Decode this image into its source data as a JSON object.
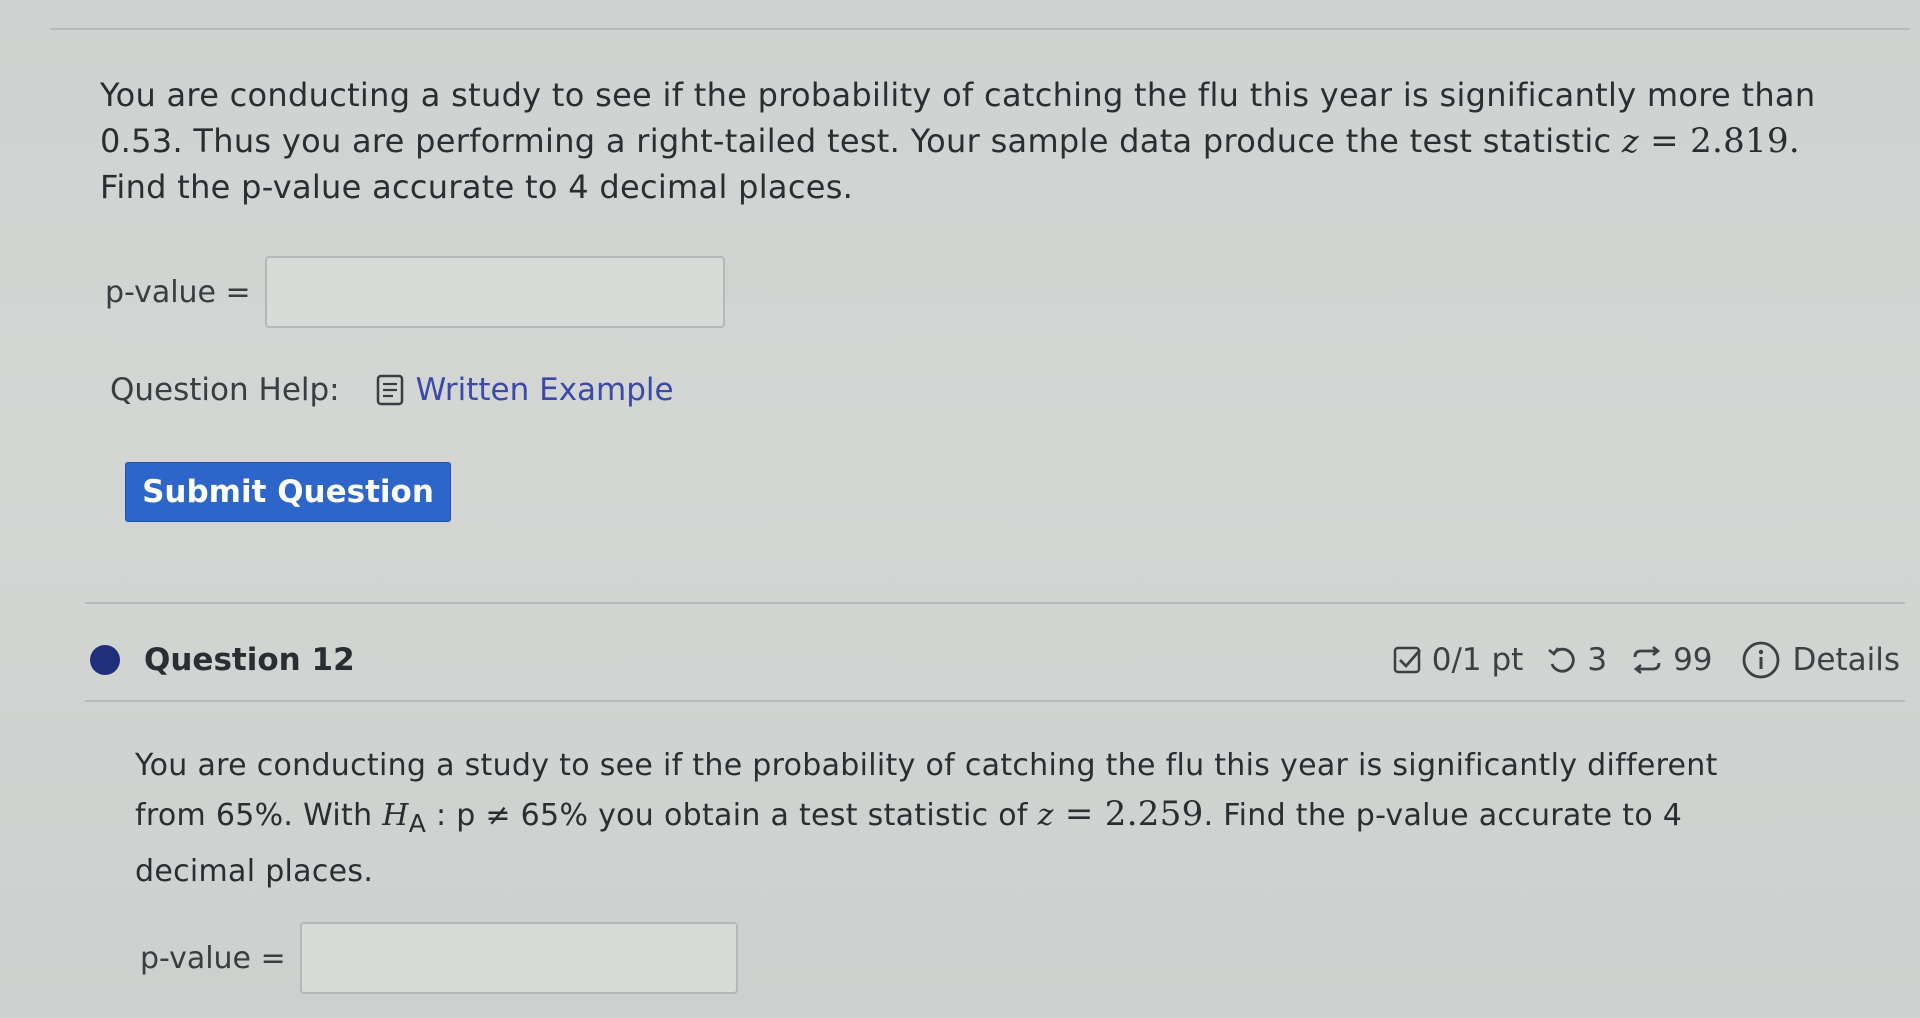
{
  "previous_question": {
    "text_line1": "You are conducting a study to see if the probability of catching the flu this year is significantly more than",
    "text_line2_pre": "0.53. Thus you are performing a right-tailed test. Your sample data produce the test statistic ",
    "stat_var": "z",
    "stat_eq": " = ",
    "stat_value": "2.819.",
    "text_line3": "Find the p-value accurate to 4 decimal places.",
    "answer_label": "p-value =",
    "answer_value": "",
    "help_label": "Question Help:",
    "help_link": "Written Example",
    "submit_label": "Submit Question"
  },
  "question_12": {
    "title": "Question 12",
    "score": "0/1 pt",
    "retries": "3",
    "attempts": "99",
    "details_label": "Details",
    "text_line1": "You are conducting a study to see if the probability of catching the flu this year is significantly different",
    "text_line2_a": "from 65%. With ",
    "hyp_var": "H",
    "hyp_sub": "A",
    "hyp_rest": " : p ≠ 65% you obtain a test statistic of ",
    "stat_var": "z",
    "stat_eq": " = ",
    "stat_value": "2.259",
    "text_line2_b": ". Find the p-value accurate to 4",
    "text_line3": "decimal places.",
    "answer_label": "p-value =",
    "answer_value": ""
  },
  "colors": {
    "submit_bg": "#2d65c8",
    "link": "#3a4aa8",
    "bullet": "#1f2f7a"
  },
  "icons": {
    "written_example": "document-icon",
    "score": "checkbox-icon",
    "retries": "undo-icon",
    "attempts": "repeat-icon",
    "details": "info-icon"
  }
}
